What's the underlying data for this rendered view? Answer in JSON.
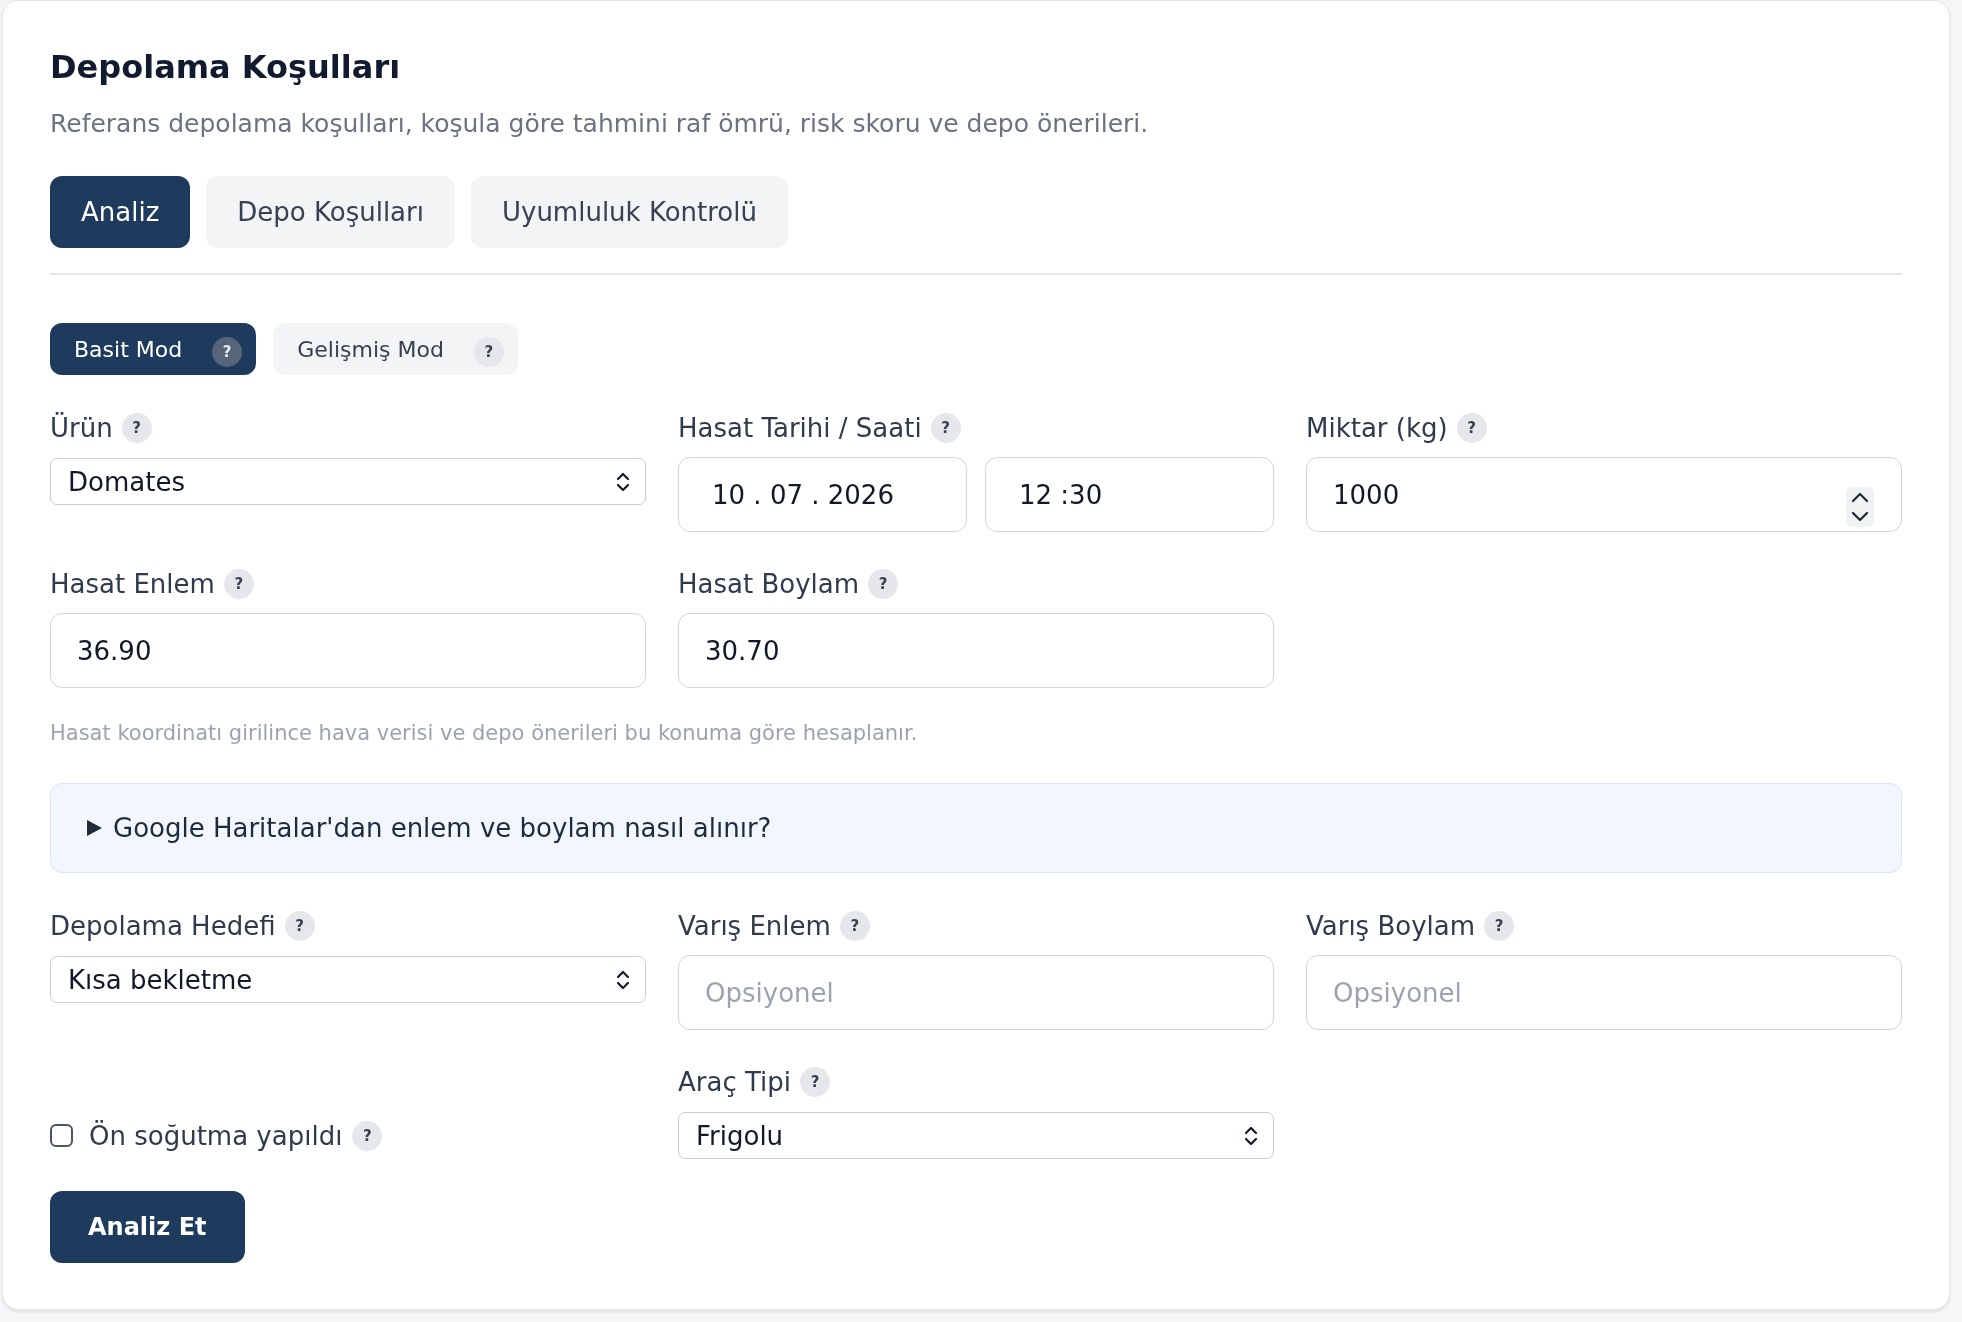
{
  "card": {
    "title": "Depolama Koşulları",
    "subtitle": "Referans depolama koşulları, koşula göre tahmini raf ömrü, risk skoru ve depo önerileri."
  },
  "tabs": [
    {
      "label": "Analiz",
      "selected": true
    },
    {
      "label": "Depo Koşulları",
      "selected": false
    },
    {
      "label": "Uyumluluk Kontrolü",
      "selected": false
    }
  ],
  "modes": [
    {
      "label": "Basit Mod",
      "help": "?",
      "selected": true
    },
    {
      "label": "Gelişmiş Mod",
      "help": "?",
      "selected": false
    }
  ],
  "harvest_fields": [
    {
      "kind": "select",
      "label": "Ürün",
      "help": "?",
      "value": "Domates"
    },
    {
      "kind": "datetime",
      "label": "Hasat Tarihi / Saati",
      "help": "?",
      "date": "10 . 07 . 2026",
      "time": "12 :30"
    },
    {
      "kind": "number",
      "label": "Miktar (kg)",
      "help": "?",
      "value": "1000"
    },
    {
      "kind": "input",
      "label": "Hasat Enlem",
      "help": "?",
      "value": "36.90"
    },
    {
      "kind": "input",
      "label": "Hasat Boylam",
      "help": "?",
      "value": "30.70"
    }
  ],
  "hint": "Hasat koordinatı girilince hava verisi ve depo önerileri bu konuma göre hesaplanır.",
  "help_disclosure": {
    "label": "Google Haritalar'dan enlem ve boylam nasıl alınır?",
    "expanded": false
  },
  "destination_fields": [
    {
      "kind": "select",
      "label": "Depolama Hedefi",
      "help": "?",
      "value": "Kısa bekletme"
    },
    {
      "kind": "input",
      "label": "Varış Enlem",
      "help": "?",
      "placeholder": "Opsiyonel"
    },
    {
      "kind": "input",
      "label": "Varış Boylam",
      "help": "?",
      "placeholder": "Opsiyonel"
    },
    {
      "kind": "checkbox",
      "label": "Ön soğutma yapıldı",
      "help": "?",
      "checked": false
    },
    {
      "kind": "select",
      "label": "Araç Tipi",
      "help": "?",
      "value": "Frigolu"
    }
  ],
  "submit_button": "Analiz Et"
}
